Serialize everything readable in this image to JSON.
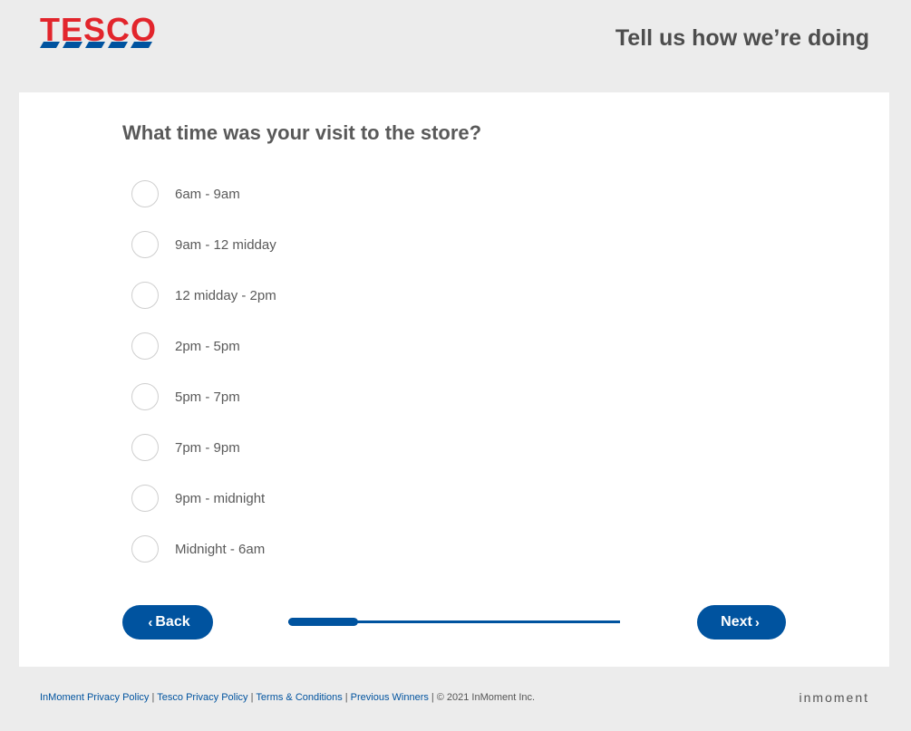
{
  "header": {
    "logo_text": "TESCO",
    "tagline": "Tell us how we’re doing"
  },
  "survey": {
    "question": "What time was your visit to the store?",
    "options": [
      "6am - 9am",
      "9am - 12 midday",
      "12 midday - 2pm",
      "2pm - 5pm",
      "5pm - 7pm",
      "7pm - 9pm",
      "9pm - midnight",
      "Midnight - 6am"
    ],
    "selected": null
  },
  "navigation": {
    "back_label": "Back",
    "next_label": "Next",
    "progress_fraction": 0.21
  },
  "footer": {
    "links": [
      "InMoment Privacy Policy",
      "Tesco Privacy Policy",
      "Terms & Conditions",
      "Previous Winners"
    ],
    "copyright": "© 2021 InMoment Inc.",
    "brand": "inmoment"
  },
  "colors": {
    "brand_red": "#e2252c",
    "brand_blue": "#00539f",
    "background": "#ececec"
  },
  "icons": {
    "back": "chevron-left-icon",
    "next": "chevron-right-icon"
  }
}
